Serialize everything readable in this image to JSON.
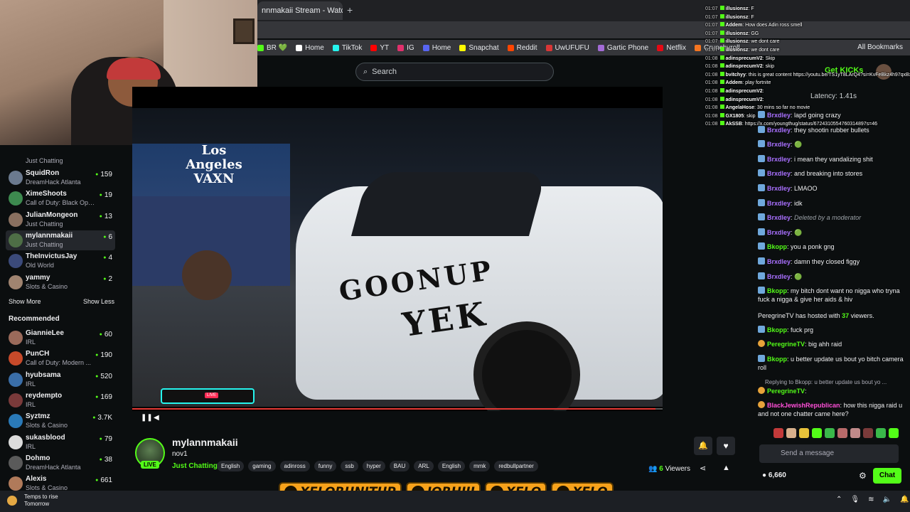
{
  "browser": {
    "tab_title": "nnmakaii Stream - Watch Live",
    "bookmarks": [
      {
        "label": "BR 💚",
        "color": "#53fc18"
      },
      {
        "label": "Home",
        "color": "#ffffff"
      },
      {
        "label": "TikTok",
        "color": "#25f4ee"
      },
      {
        "label": "YT",
        "color": "#ff0000"
      },
      {
        "label": "IG",
        "color": "#e1306c"
      },
      {
        "label": "Home",
        "color": "#5865f2"
      },
      {
        "label": "Snapchat",
        "color": "#fffc00"
      },
      {
        "label": "Reddit",
        "color": "#ff4500"
      },
      {
        "label": "UwUFUFU",
        "color": "#d93636"
      },
      {
        "label": "Gartic Phone",
        "color": "#a36bd6"
      },
      {
        "label": "Netflix",
        "color": "#e50914"
      },
      {
        "label": "Crunchyroll",
        "color": "#f47521"
      }
    ],
    "all_bookmarks": "All Bookmarks"
  },
  "kick": {
    "search_placeholder": "Search",
    "get_kicks": "Get KICKs"
  },
  "sidebar": {
    "first_category": "Just Chatting",
    "items": [
      {
        "name": "SquidRon",
        "category": "DreamHack Atlanta",
        "viewers": "159",
        "avatar": "#6b7a8f"
      },
      {
        "name": "XimeShoots",
        "category": "Call of Duty: Black Ops 6",
        "viewers": "19",
        "avatar": "#3d8a4f"
      },
      {
        "name": "JulianMongeon",
        "category": "Just Chatting",
        "viewers": "13",
        "avatar": "#8a7060"
      },
      {
        "name": "mylannmakaii",
        "category": "Just Chatting",
        "viewers": "6",
        "avatar": "#4e6e46"
      },
      {
        "name": "TheInvictusJay",
        "category": "Old World",
        "viewers": "4",
        "avatar": "#3b4a7a"
      },
      {
        "name": "yammy",
        "category": "Slots & Casino",
        "viewers": "2",
        "avatar": "#a08470"
      }
    ],
    "show_more": "Show More",
    "show_less": "Show Less",
    "recommended_title": "Recommended",
    "recommended": [
      {
        "name": "GiannieLee",
        "category": "IRL",
        "viewers": "60",
        "avatar": "#9a6a5a"
      },
      {
        "name": "PunCH",
        "category": "Call of Duty: Modern ...",
        "viewers": "190",
        "avatar": "#c74a2a"
      },
      {
        "name": "hyubsama",
        "category": "IRL",
        "viewers": "520",
        "avatar": "#3a6ea8"
      },
      {
        "name": "reydempto",
        "category": "IRL",
        "viewers": "169",
        "avatar": "#7a3a3a"
      },
      {
        "name": "Syztmz",
        "category": "Slots & Casino",
        "viewers": "3.7K",
        "avatar": "#2a7ab8"
      },
      {
        "name": "sukasblood",
        "category": "IRL",
        "viewers": "79",
        "avatar": "#dcdcdc"
      },
      {
        "name": "Dohmo",
        "category": "DreamHack Atlanta",
        "viewers": "38",
        "avatar": "#5a5a5a"
      },
      {
        "name": "Alexis",
        "category": "Slots & Casino",
        "viewers": "661",
        "avatar": "#b07a5a"
      }
    ]
  },
  "video": {
    "pip_logo": "Los Angeles VAXN",
    "graffiti": [
      "GOONUP",
      "YEK"
    ],
    "progress": 0.987
  },
  "stream": {
    "channel": "mylannmakaii",
    "title": "nov1",
    "category": "Just Chatting",
    "live_badge": "LIVE",
    "tags": [
      "English",
      "gaming",
      "adinross",
      "funny",
      "ssb",
      "hyper",
      "BAU",
      "ARL",
      "English",
      "mmk",
      "redbullpartner"
    ],
    "viewers": "6",
    "viewers_label": "Viewers"
  },
  "chat": {
    "latency": "Latency: 1.41s",
    "messages": [
      {
        "user": "Brxdley",
        "color": "#a970ff",
        "text": "lapd going crazy"
      },
      {
        "user": "Brxdley",
        "color": "#a970ff",
        "text": "they shootin rubber bullets"
      },
      {
        "user": "Brxdley",
        "color": "#a970ff",
        "text": "🟢"
      },
      {
        "user": "Brxdley",
        "color": "#a970ff",
        "text": "i mean they vandalizing shit"
      },
      {
        "user": "Brxdley",
        "color": "#a970ff",
        "text": "and breaking into stores"
      },
      {
        "user": "Brxdley",
        "color": "#a970ff",
        "text": "LMAOO"
      },
      {
        "user": "Brxdley",
        "color": "#a970ff",
        "text": "idk"
      },
      {
        "user": "Brxdley",
        "color": "#a970ff",
        "text": "Deleted by a moderator",
        "mod": true
      },
      {
        "user": "Brxdley",
        "color": "#a970ff",
        "text": "🟢"
      },
      {
        "user": "Bkopp",
        "color": "#53fc18",
        "text": "you a ponk gng"
      },
      {
        "user": "Brxdley",
        "color": "#a970ff",
        "text": "damn they closed figgy"
      },
      {
        "user": "Brxdley",
        "color": "#a970ff",
        "text": "🟢"
      },
      {
        "user": "Bkopp",
        "color": "#53fc18",
        "text": "my bitch dont want no nigga who tryna fuck a nigga & give her aids & hiv"
      }
    ],
    "hosted": {
      "user": "PeregrineTV",
      "text": "has hosted with",
      "count": "37",
      "suffix": "viewers."
    },
    "messages2": [
      {
        "user": "Bkopp",
        "color": "#53fc18",
        "text": "fuck prg"
      },
      {
        "user": "PeregrineTV",
        "color": "#53fc18",
        "text": "big ahh raid",
        "gold": true
      },
      {
        "user": "Bkopp",
        "color": "#53fc18",
        "text": "u better update us bout yo bitch camera roll"
      }
    ],
    "replying": "Replying to Bkopp: u better update us bout yo ...",
    "messages3": [
      {
        "user": "PeregrineTV",
        "color": "#53fc18",
        "text": "",
        "gold": true
      },
      {
        "user": "BlackJewishRepublican",
        "color": "#ff4fd8",
        "text": "how this nigga raid u and not one chatter came here?",
        "gold": true
      }
    ],
    "input_placeholder": "Send a message",
    "points": "6,660",
    "send_label": "Chat"
  },
  "overlay_chat": [
    {
      "time": "01:07",
      "user": "illusionsz",
      "text": "F"
    },
    {
      "time": "01:07",
      "user": "illusionsz",
      "text": "F"
    },
    {
      "time": "01:07",
      "user": "Addem",
      "text": "How does Adin ross smell"
    },
    {
      "time": "01:07",
      "user": "illusionsz",
      "text": "GG"
    },
    {
      "time": "01:07",
      "user": "illusionsz",
      "text": "we dont care"
    },
    {
      "time": "01:07",
      "user": "illusionsz",
      "text": "we dont care"
    },
    {
      "time": "01:08",
      "user": "adinsprecumV2",
      "text": "Skip"
    },
    {
      "time": "01:08",
      "user": "adinsprecumV2",
      "text": "skip"
    },
    {
      "time": "01:08",
      "user": "bvitchyy",
      "text": "this is great content https://youtu.be/TS1yT8LArQ4?si=KvFeBkz4h97qxBxV&t=14"
    },
    {
      "time": "01:08",
      "user": "Addem",
      "text": "play fortnite"
    },
    {
      "time": "01:08",
      "user": "adinsprecumV2",
      "text": ""
    },
    {
      "time": "01:08",
      "user": "adinsprecumV2",
      "text": ""
    },
    {
      "time": "01:08",
      "user": "AngelaHose",
      "text": "30 mins so far no movie"
    },
    {
      "time": "01:08",
      "user": "GX1805",
      "text": "skip"
    },
    {
      "time": "01:08",
      "user": "AkSSB",
      "text": "https://x.com/youngthug/status/6724310554760314897s=46"
    }
  ],
  "banner": {
    "items": [
      "XELORUNITUP",
      "JORHIII",
      "XELO",
      "XELO"
    ]
  },
  "taskbar": {
    "weather_line1": "Temps to rise",
    "weather_line2": "Tomorrow"
  }
}
